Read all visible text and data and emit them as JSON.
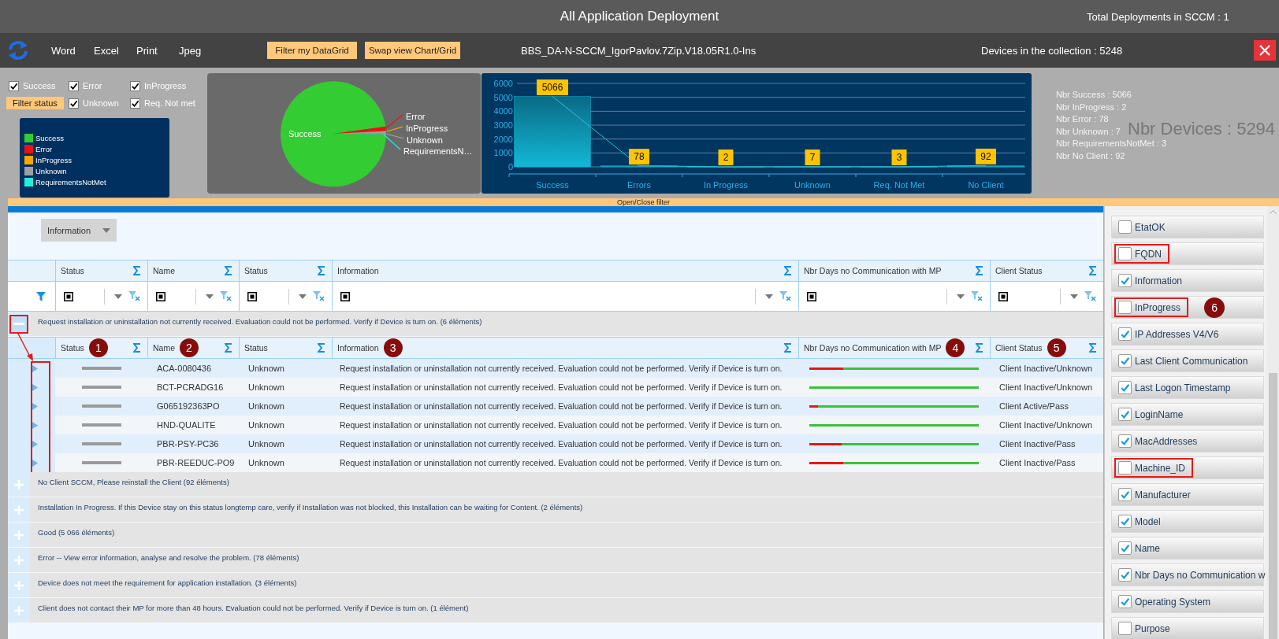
{
  "window": {
    "title": "All Application Deployment",
    "total": "Total Deployments in SCCM : 1"
  },
  "toolbar": {
    "menu": [
      "Word",
      "Excel",
      "Print",
      "Jpeg"
    ],
    "buttons": [
      "Filter my DataGrid",
      "Swap view Chart/Grid"
    ],
    "deployment": "BBS_DA-N-SCCM_IgorPavlov.7Zip.V18.05R1.0-Ins",
    "devices": "Devices in the collection : 5248"
  },
  "status_filter": {
    "checks": [
      {
        "label": "Success",
        "checked": true
      },
      {
        "label": "Error",
        "checked": true
      },
      {
        "label": "InProgress",
        "checked": true
      },
      {
        "label": "Unknown",
        "checked": true
      },
      {
        "label": "Req. Not met",
        "checked": true
      }
    ],
    "button": "Filter status"
  },
  "legend": [
    {
      "label": "Success",
      "color": "#33cc33"
    },
    {
      "label": "Error",
      "color": "#ee1111"
    },
    {
      "label": "InProgress",
      "color": "#ffa500"
    },
    {
      "label": "Unknown",
      "color": "#a0a0a0"
    },
    {
      "label": "RequirementsNotMet",
      "color": "#22eedd"
    }
  ],
  "pie": {
    "inner_label": "Success",
    "labels": [
      "Error",
      "InProgress",
      "Unknown",
      "RequirementsN…"
    ]
  },
  "bar_chart": {
    "chart_data": {
      "type": "bar",
      "categories": [
        "Success",
        "Errors",
        "In Progress",
        "Unknown",
        "Req. Not Met",
        "No Client"
      ],
      "values": [
        5066,
        78,
        2,
        7,
        3,
        92
      ],
      "ylim": [
        0,
        6000
      ],
      "grid": true,
      "yticks": [
        0,
        1000,
        2000,
        3000,
        4000,
        5000,
        6000
      ],
      "data_labels": true
    }
  },
  "stats": {
    "lines": [
      "Nbr Success : 5066",
      "Nbr InProgress : 2",
      "Nbr Error : 78",
      "Nbr Unknown : 7",
      "Nbr RequirementsNotMet : 3",
      "Nbr No Client : 92"
    ],
    "total": "Nbr Devices : 5294"
  },
  "filter_toggle": "Open/Close filter",
  "grid": {
    "group_by": "Information",
    "columns": [
      "Status",
      "Name",
      "Status",
      "Information",
      "Nbr Days no Communication with MP",
      "Client Status"
    ],
    "groups": [
      {
        "label": "Request installation or uninstallation not currently received. Evaluation could not be performed. Verify if Device is turn on. (6 éléments)",
        "expanded": true,
        "annotated": true,
        "subheader": [
          {
            "label": "Status",
            "badge": "1"
          },
          {
            "label": "Name",
            "badge": "2"
          },
          {
            "label": "Status"
          },
          {
            "label": "Information",
            "badge": "3"
          },
          {
            "label": "Nbr Days no Communication with MP",
            "badge": "4"
          },
          {
            "label": "Client Status",
            "badge": "5"
          }
        ],
        "rows": [
          {
            "name": "ACA-0080436",
            "status": "Unknown",
            "information": "Request installation or uninstallation not currently received. Evaluation could not be performed. Verify if Device is turn on.",
            "level": 0.2,
            "client_status": "Client Inactive/Unknown"
          },
          {
            "name": "BCT-PCRADG16",
            "status": "Unknown",
            "information": "Request installation or uninstallation not currently received. Evaluation could not be performed. Verify if Device is turn on.",
            "level": 0,
            "client_status": "Client Inactive/Unknown"
          },
          {
            "name": "G065192363PO",
            "status": "Unknown",
            "information": "Request installation or uninstallation not currently received. Evaluation could not be performed. Verify if Device is turn on.",
            "level": 0.05,
            "client_status": "Client Active/Pass"
          },
          {
            "name": "HND-QUALITE",
            "status": "Unknown",
            "information": "Request installation or uninstallation not currently received. Evaluation could not be performed. Verify if Device is turn on.",
            "level": 0,
            "client_status": "Client Inactive/Unknown"
          },
          {
            "name": "PBR-PSY-PC36",
            "status": "Unknown",
            "information": "Request installation or uninstallation not currently received. Evaluation could not be performed. Verify if Device is turn on.",
            "level": 0.19,
            "client_status": "Client Inactive/Pass"
          },
          {
            "name": "PBR-REEDUC-PO9",
            "status": "Unknown",
            "information": "Request installation or uninstallation not currently received. Evaluation could not be performed. Verify if Device is turn on.",
            "level": 0.2,
            "client_status": "Client Inactive/Pass"
          }
        ]
      },
      {
        "label": "No Client SCCM, Please reinstall the Client (92 éléments)",
        "expanded": false,
        "annotated": false
      },
      {
        "label": "Installation In Progress. If this Device stay on this status longtemp care, verify if Installation was not blocked, this Installation can be waiting for Content. (2 éléments)",
        "expanded": false,
        "annotated": false
      },
      {
        "label": "Good (5 066 éléments)",
        "expanded": false,
        "annotated": false
      },
      {
        "label": "Error -- View error information, analyse and resolve the problem. (78 éléments)",
        "expanded": false,
        "annotated": false
      },
      {
        "label": "Device does not meet the requirement for application installation. (3 éléments)",
        "expanded": false,
        "annotated": false
      },
      {
        "label": "Client does not contact their MP for more than 48 hours. Evaluation could not be performed. Verify if Device is turn on. (1 élément)",
        "expanded": false,
        "annotated": false
      }
    ]
  },
  "column_chooser": [
    {
      "label": "EtatOK",
      "checked": false,
      "highlighted": false
    },
    {
      "label": "FQDN",
      "checked": false,
      "highlighted": true
    },
    {
      "label": "Information",
      "checked": true,
      "highlighted": false
    },
    {
      "label": "InProgress",
      "checked": false,
      "highlighted": true,
      "badge": "6"
    },
    {
      "label": "IP Addresses V4/V6",
      "checked": true,
      "highlighted": false
    },
    {
      "label": "Last Client Communication",
      "checked": true,
      "highlighted": false
    },
    {
      "label": "Last Logon Timestamp",
      "checked": true,
      "highlighted": false
    },
    {
      "label": "LoginName",
      "checked": true,
      "highlighted": false
    },
    {
      "label": "MacAddresses",
      "checked": true,
      "highlighted": false
    },
    {
      "label": "Machine_ID",
      "checked": false,
      "highlighted": true
    },
    {
      "label": "Manufacturer",
      "checked": true,
      "highlighted": false
    },
    {
      "label": "Model",
      "checked": true,
      "highlighted": false
    },
    {
      "label": "Name",
      "checked": true,
      "highlighted": false
    },
    {
      "label": "Nbr Days no Communication w",
      "checked": true,
      "highlighted": false
    },
    {
      "label": "Operating System",
      "checked": true,
      "highlighted": false
    },
    {
      "label": "Purpose",
      "checked": false,
      "highlighted": false
    }
  ]
}
